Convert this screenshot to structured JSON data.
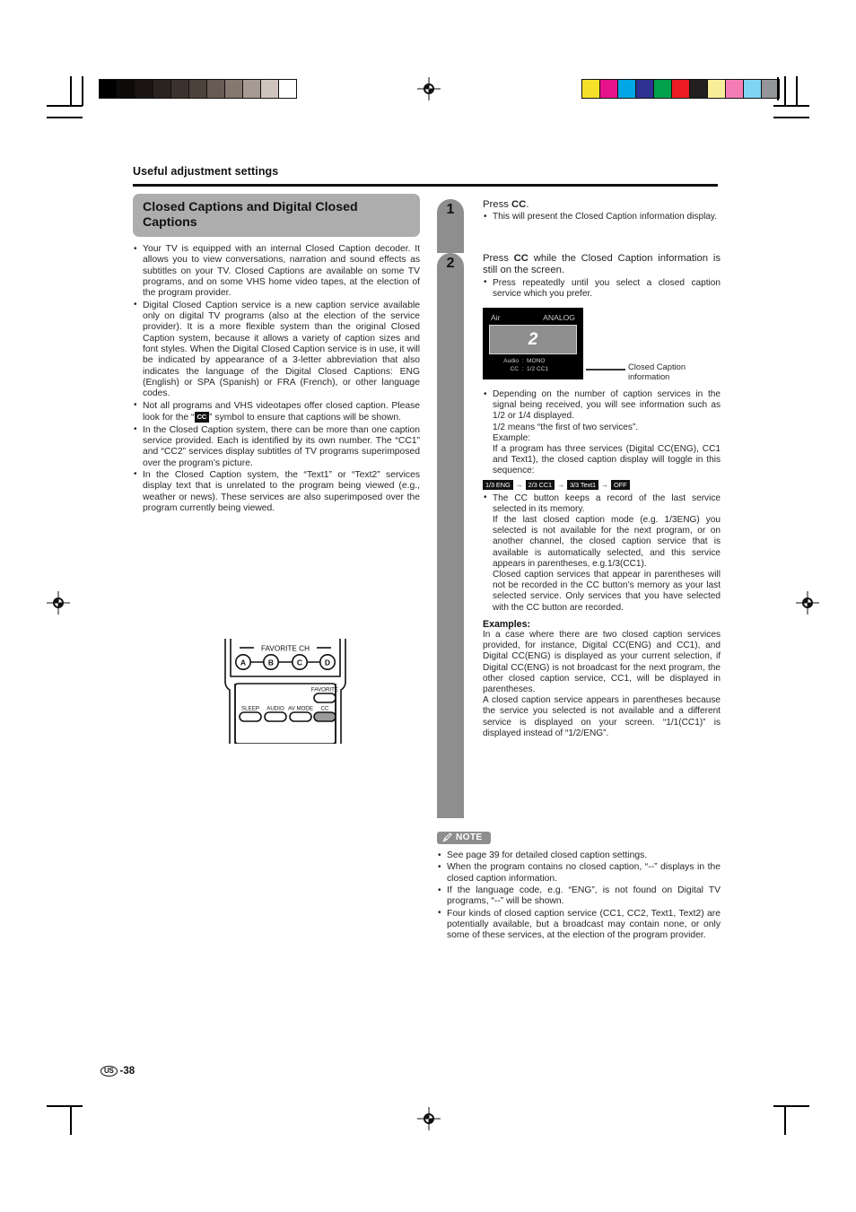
{
  "page": {
    "running_head": "Useful adjustment settings",
    "page_label": "US",
    "page_number": "-38"
  },
  "print_marks": {
    "grayscale_swatches": [
      "#000000",
      "#0d0a0a",
      "#1b1614",
      "#2b2320",
      "#3b312c",
      "#4c413b",
      "#675b54",
      "#85786f",
      "#a79a92",
      "#cfc4bd",
      "#ffffff"
    ],
    "color_swatches": [
      "#f5e02a",
      "#e6128c",
      "#00a7e4",
      "#2e3192",
      "#00a14b",
      "#ed1c24",
      "#231f20",
      "#faed9a",
      "#f47db6",
      "#7fd4f4",
      "#939598"
    ]
  },
  "left_column": {
    "heading": "Closed Captions and Digital Closed Captions",
    "bullets": [
      "Your TV is equipped with an internal Closed Caption decoder. It allows you to view conversations, narration and sound effects as subtitles on your TV. Closed Captions are available on some TV programs, and on some VHS home video tapes, at the election of the program provider.",
      "Digital Closed Caption service is a new caption service available only on digital TV programs (also at the election of the service provider).  It is a more flexible system than the original Closed Caption system, because it allows a variety of caption sizes and font styles. When the Digital Closed Caption service is in use, it will be indicated by appearance of a 3-letter abbreviation that also indicates the language of the Digital Closed Captions: ENG (English) or SPA (Spanish) or FRA (French), or other language codes.",
      "In the Closed Caption system, there can be more than one caption service provided.  Each is identified by its own number.  The “CC1” and “CC2” services display subtitles of TV programs superimposed over the program’s picture.",
      "In the Closed Caption system, the “Text1” or “Text2” services display text that is unrelated to the program being viewed (e.g., weather or news). These services are also superimposed over the program currently being viewed."
    ],
    "bullet_cc_symbol": {
      "prefix": "Not all programs and VHS videotapes offer closed caption. Please look for the “",
      "symbol": "CC",
      "suffix": "” symbol to ensure that captions will be shown."
    }
  },
  "remote": {
    "favorite_ch_label": "FAVORITE CH",
    "channel_buttons": [
      "A",
      "B",
      "C",
      "D"
    ],
    "favorite_label": "FAVORITE",
    "function_buttons": [
      "SLEEP",
      "AUDIO",
      "AV MODE",
      "CC"
    ],
    "highlighted_button": "CC"
  },
  "right_column": {
    "steps": [
      {
        "number": "1",
        "instruction_pre": "Press ",
        "instruction_key": "CC",
        "instruction_post": ".",
        "substeps": [
          "This will present the Closed Caption information display."
        ]
      },
      {
        "number": "2",
        "instruction_pre": "Press ",
        "instruction_key": "CC",
        "instruction_post": " while the Closed Caption information is still on the screen.",
        "substeps": [
          "Press repeatedly until you select a closed caption service which you prefer."
        ]
      }
    ],
    "osd": {
      "source": "Air",
      "signal": "ANALOG",
      "channel": "2",
      "rows": [
        {
          "key": "Audio",
          "colon": ":",
          "value": "MONO"
        },
        {
          "key": "CC",
          "colon": ":",
          "value": "1/2 CC1"
        }
      ],
      "callout": "Closed Caption information"
    },
    "bullet_services": "Depending on the number of caption services in the signal being received, you will see information such as 1/2 or 1/4 displayed.",
    "means_line": "1/2 means “the first of two services”.",
    "example_label": "Example:",
    "example_text": "If a program has three services (Digital CC(ENG), CC1 and Text1), the closed caption display will toggle in this sequence:",
    "toggle_sequence": [
      "1/3 ENG",
      "2/3 CC1",
      "3/3 Text1",
      "OFF"
    ],
    "toggle_arrow": "→",
    "bullet_memory": "The CC button keeps a record of the last service selected in its memory.",
    "memory_para1": "If the last closed caption mode (e.g. 1/3ENG) you selected is not available for the next program, or on another channel, the closed caption service that is available is automatically selected, and this service appears in parentheses, e.g.1/3(CC1).",
    "memory_para2": "Closed caption services that appear in parentheses will not be recorded in the CC button’s memory as your last selected service. Only services that you have selected with the CC button are recorded.",
    "examples_label": "Examples:",
    "examples_para1": "In a case where there are two closed caption services provided, for instance, Digital CC(ENG) and CC1), and Digital CC(ENG) is displayed as your current selection, if Digital CC(ENG) is not broadcast for the next program, the other closed caption service, CC1, will be displayed in parentheses.",
    "examples_para2": "A closed caption service appears in parentheses because the service you selected is not available and a different service is displayed on your screen.  “1/1(CC1)” is displayed instead of “1/2/ENG”.",
    "note_label": "NOTE",
    "notes": [
      "See page 39 for detailed closed caption settings.",
      "When the program contains no closed caption, “--” displays in the closed caption information.",
      "If the language code, e.g. “ENG”, is not found on Digital TV programs, “--” will be shown.",
      "Four kinds of closed caption service (CC1, CC2, Text1, Text2) are potentially available, but a broadcast may contain none, or only some of these services, at the election of the program provider."
    ]
  }
}
